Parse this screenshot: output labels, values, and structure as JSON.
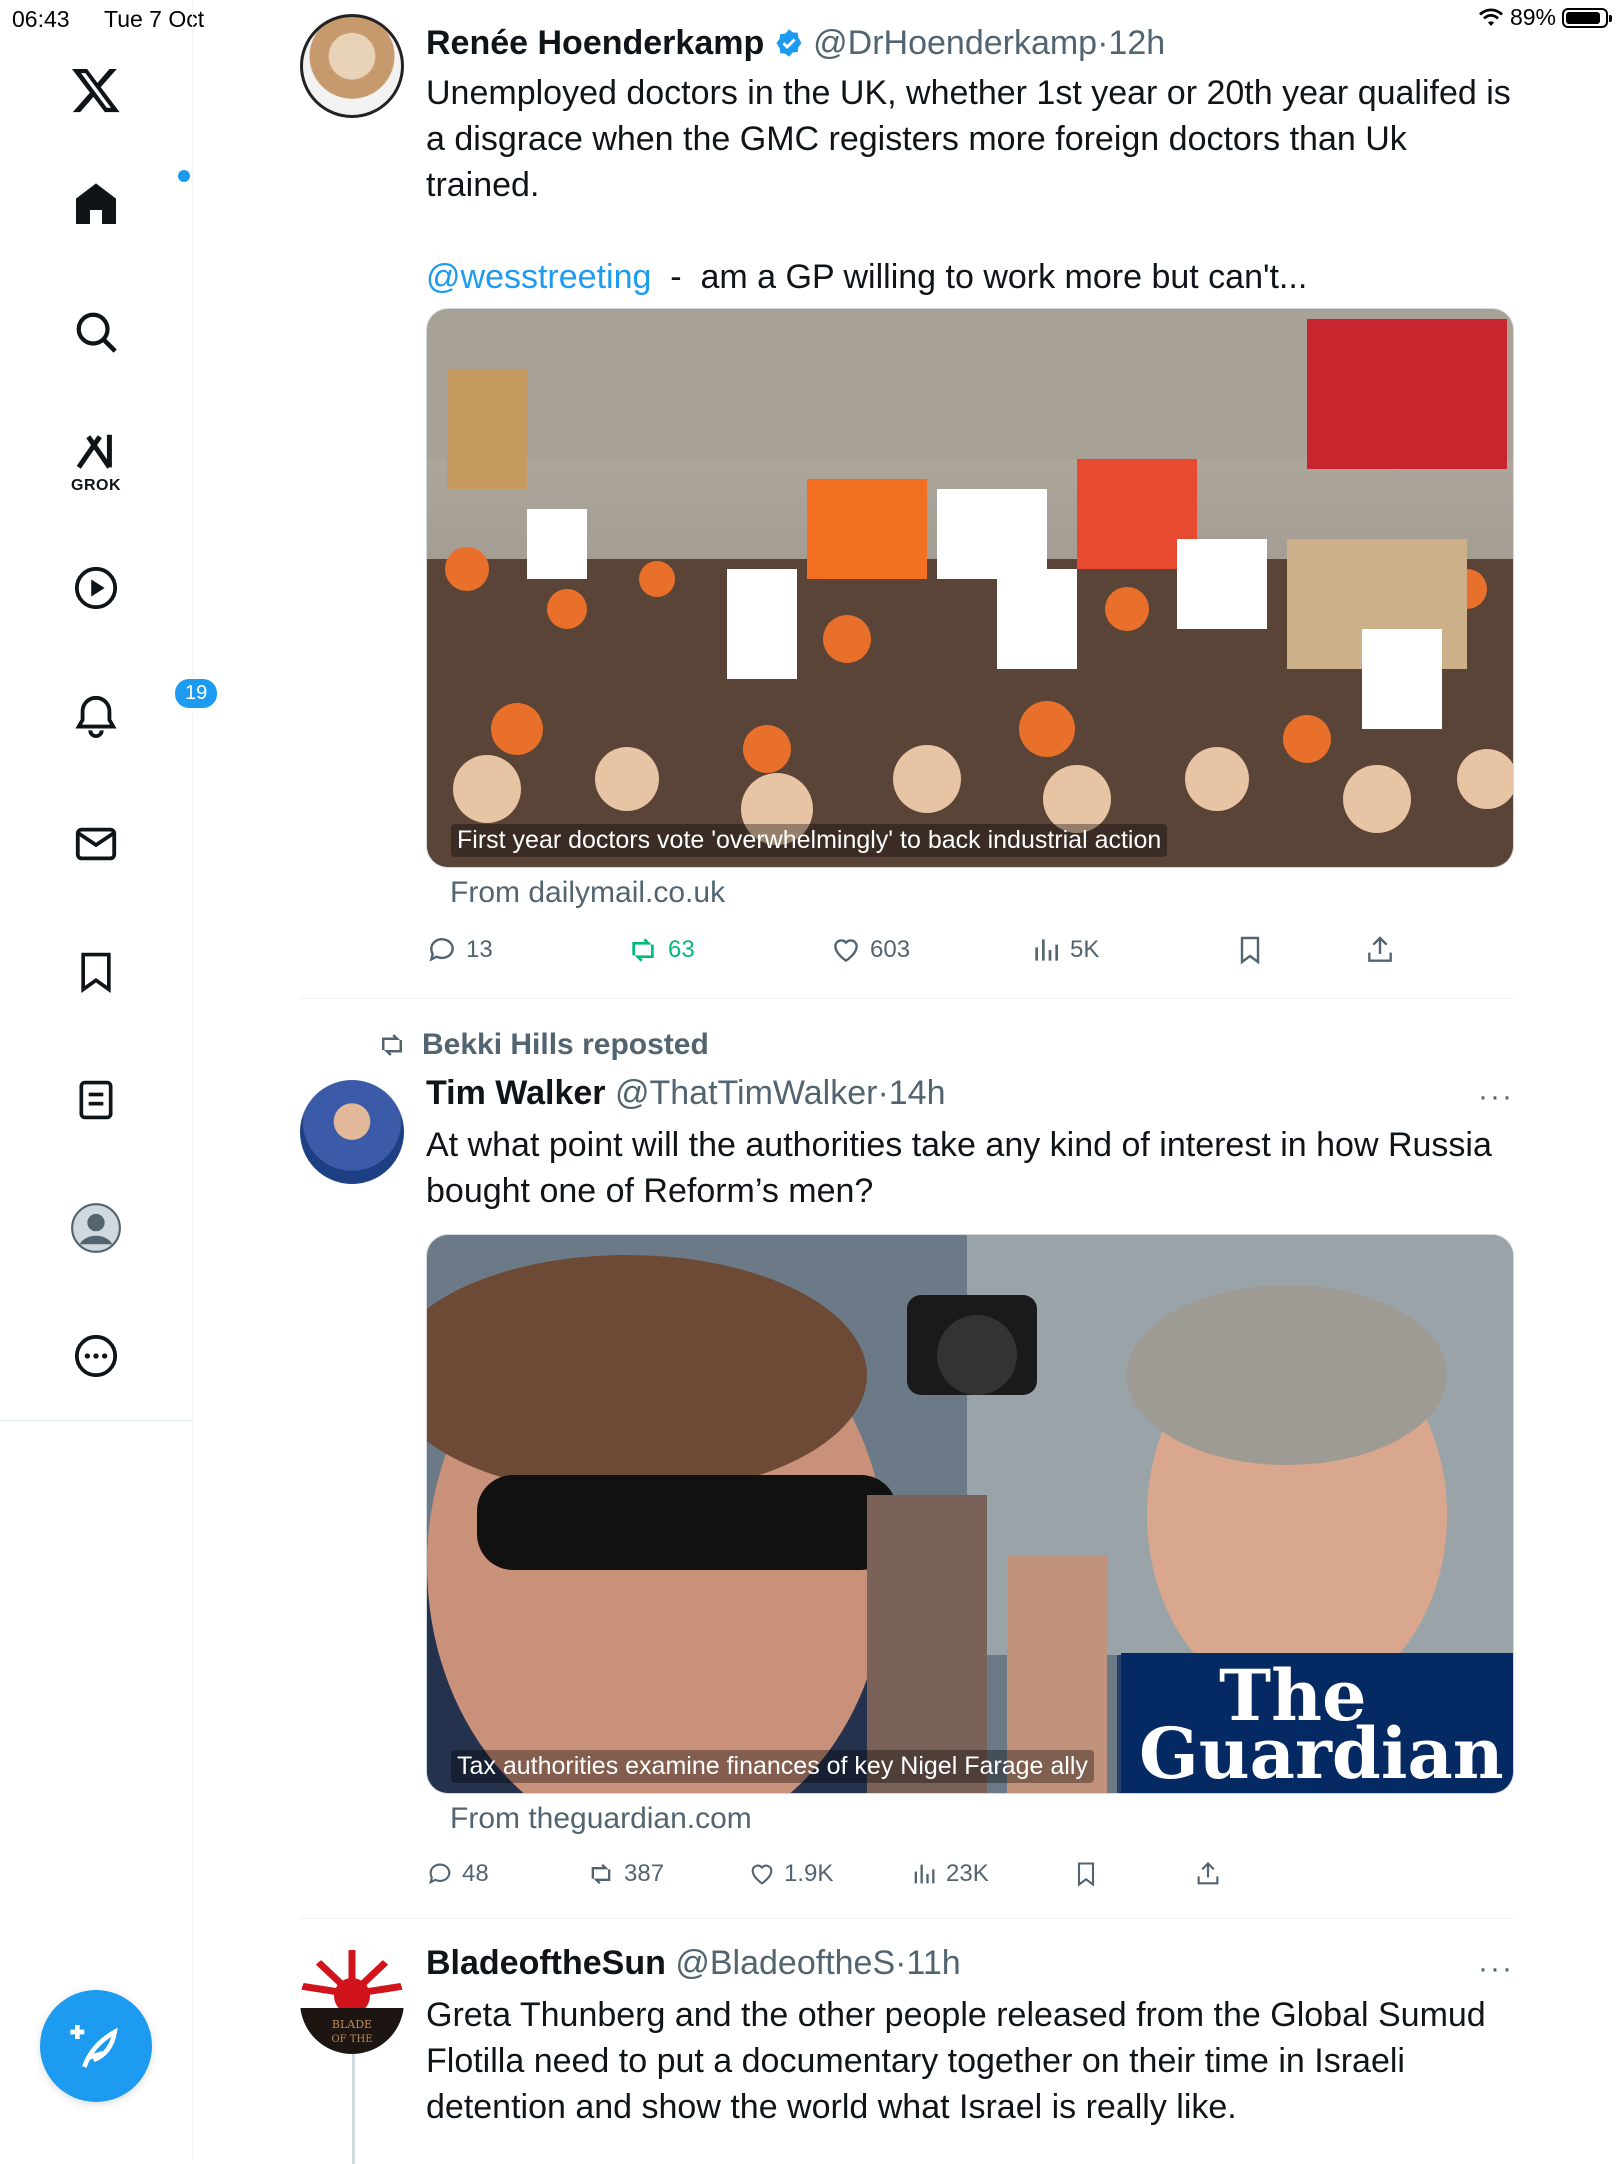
{
  "status": {
    "time": "06:43",
    "date": "Tue 7 Oct",
    "battery": "89%",
    "battery_level": 0.89
  },
  "nav": {
    "grok_label": "GROK",
    "notifications_count": "19"
  },
  "tweets": [
    {
      "name": "Renée Hoenderkamp",
      "handle": "@DrHoenderkamp",
      "dot": "·",
      "time": "12h",
      "verified": true,
      "text1": "Unemployed doctors in the UK, whether 1st year or 20th year qualifed is a disgrace when the GMC registers more foreign doctors than Uk trained.",
      "mention": "@wesstreeting",
      "text2": "  -  am a GP willing to work more but can't...",
      "card_caption": "First year doctors vote 'overwhelmingly' to back industrial action",
      "card_from": "From dailymail.co.uk",
      "replies": "13",
      "reposts": "63",
      "likes": "603",
      "views": "5K"
    },
    {
      "reposted_by": "Bekki Hills reposted",
      "name": "Tim Walker",
      "handle": "@ThatTimWalker",
      "dot": "·",
      "time": "14h",
      "text": "At what point will the authorities take any kind of interest in how Russia bought one of Reform’s men?",
      "card_caption": "Tax authorities examine finances of key Nigel Farage ally",
      "card_brand": [
        "The",
        "Guardian"
      ],
      "card_from": "From theguardian.com",
      "replies": "48",
      "reposts": "387",
      "likes": "1.9K",
      "views": "23K"
    },
    {
      "name": "BladeoftheSun",
      "handle": "@BladeoftheS",
      "dot": "·",
      "time": "11h",
      "text": "Greta Thunberg and the other people released from the Global Sumud Flotilla need to put a documentary together on their time in Israeli detention and show the world what Israel is really like.",
      "avatar_text": [
        "BLADE",
        "OF THE"
      ]
    }
  ],
  "icons": {
    "more": "more-dots-icon",
    "reply": "reply-icon",
    "repost": "repost-icon",
    "like": "like-icon",
    "views": "views-icon",
    "bookmark": "bookmark-icon",
    "share": "share-icon"
  },
  "colors": {
    "accent": "#1d9bf0",
    "repost_green": "#00ba7c",
    "muted": "#536471"
  }
}
